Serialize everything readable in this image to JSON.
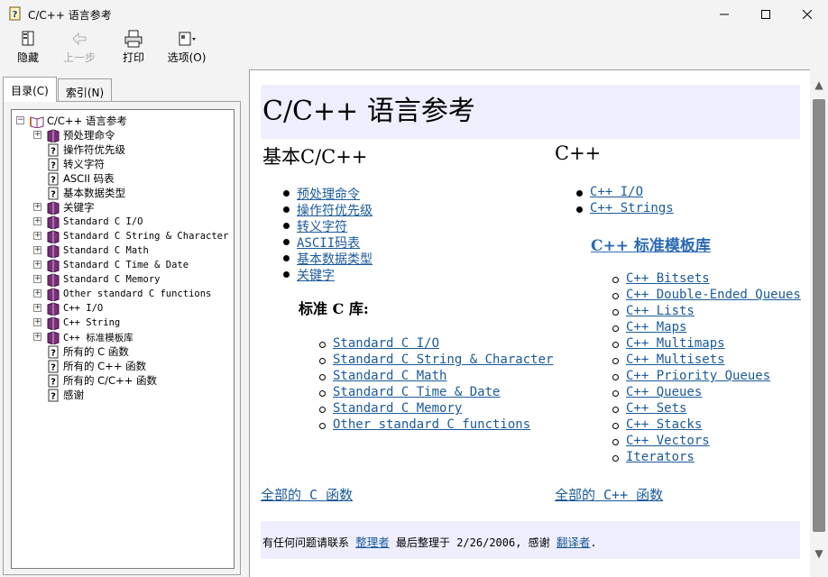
{
  "window": {
    "title": "C/C++ 语言参考",
    "minimize": "—",
    "maximize": "☐",
    "close": "✕"
  },
  "toolbar": [
    {
      "name": "hide-button",
      "label": "隐藏",
      "icon": "hide-icon",
      "enabled": true
    },
    {
      "name": "back-button",
      "label": "上一步",
      "icon": "back-arrow-icon",
      "enabled": false
    },
    {
      "name": "print-button",
      "label": "打印",
      "icon": "printer-icon",
      "enabled": true
    },
    {
      "name": "options-button",
      "label": "选项(O)",
      "icon": "options-icon",
      "enabled": true
    }
  ],
  "tabs": {
    "contents": "目录(C)",
    "index": "索引(N)"
  },
  "tree": [
    {
      "label": "C/C++ 语言参考",
      "type": "book-open",
      "level": 0,
      "expander": "−"
    },
    {
      "label": "预处理命令",
      "type": "book",
      "level": 1,
      "expander": "+"
    },
    {
      "label": "操作符优先级",
      "type": "page",
      "level": 1,
      "expander": ""
    },
    {
      "label": "转义字符",
      "type": "page",
      "level": 1,
      "expander": ""
    },
    {
      "label": "ASCII 码表",
      "type": "page",
      "level": 1,
      "expander": ""
    },
    {
      "label": "基本数据类型",
      "type": "page",
      "level": 1,
      "expander": ""
    },
    {
      "label": "关键字",
      "type": "book",
      "level": 1,
      "expander": "+"
    },
    {
      "label": "Standard C I/O",
      "type": "book",
      "level": 1,
      "expander": "+"
    },
    {
      "label": "Standard C String & Character",
      "type": "book",
      "level": 1,
      "expander": "+"
    },
    {
      "label": "Standard C Math",
      "type": "book",
      "level": 1,
      "expander": "+"
    },
    {
      "label": "Standard C Time & Date",
      "type": "book",
      "level": 1,
      "expander": "+"
    },
    {
      "label": "Standard C Memory",
      "type": "book",
      "level": 1,
      "expander": "+"
    },
    {
      "label": "Other standard C functions",
      "type": "book",
      "level": 1,
      "expander": "+"
    },
    {
      "label": "C++ I/O",
      "type": "book",
      "level": 1,
      "expander": "+"
    },
    {
      "label": "C++ String",
      "type": "book",
      "level": 1,
      "expander": "+"
    },
    {
      "label": "C++ 标准模板库",
      "type": "book",
      "level": 1,
      "expander": "+"
    },
    {
      "label": "所有的 C 函数",
      "type": "page",
      "level": 1,
      "expander": ""
    },
    {
      "label": "所有的 C++ 函数",
      "type": "page",
      "level": 1,
      "expander": ""
    },
    {
      "label": "所有的 C/C++ 函数",
      "type": "page",
      "level": 1,
      "expander": ""
    },
    {
      "label": "感谢",
      "type": "page",
      "level": 1,
      "expander": ""
    }
  ],
  "page": {
    "title": "C/C++ 语言参考",
    "basic_heading": "基本C/C++",
    "basic_links": [
      "预处理命令",
      "操作符优先级",
      "转义字符",
      "ASCII码表",
      "基本数据类型",
      "关键字"
    ],
    "stdc_heading": "标准 C 库:",
    "stdc_links": [
      "Standard C I/O",
      "Standard C String & Character",
      "Standard C Math",
      "Standard C Time & Date",
      "Standard C Memory",
      "Other standard C functions"
    ],
    "cpp_heading": "C++",
    "cpp_links": [
      "C++ I/O",
      "C++ Strings"
    ],
    "stl_heading": "C++ 标准模板库",
    "stl_links": [
      "C++ Bitsets",
      "C++ Double-Ended Queues",
      "C++ Lists",
      "C++ Maps",
      "C++ Multimaps",
      "C++ Multisets",
      "C++ Priority Queues",
      "C++ Queues",
      "C++ Sets",
      "C++ Stacks",
      "C++ Vectors",
      "Iterators"
    ],
    "all_c": "全部的 C 函数",
    "all_cpp": "全部的 C++ 函数",
    "footer": {
      "text1": "有任何问题请联系 ",
      "link1": "整理者",
      "text2": " 最后整理于 2/26/2006, 感谢 ",
      "link2": "翻译者",
      "text3": "."
    }
  },
  "scrollbar": {
    "up": "▲",
    "down": "▼"
  }
}
